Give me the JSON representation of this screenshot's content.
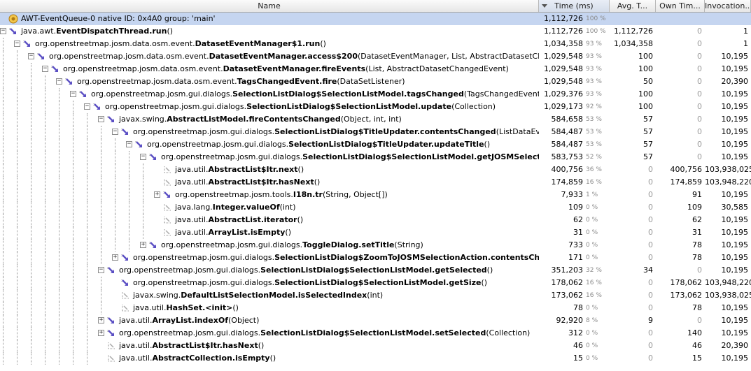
{
  "header": {
    "name": "Name",
    "time": "Time (ms)",
    "avg": "Avg. T...",
    "own": "Own Tim...",
    "inv": "Invocation..."
  },
  "rows": [
    {
      "depth": 0,
      "exp": "",
      "icon": "thread",
      "pre": "AWT-EventQueue-0 native ID: 0x4A0 group: 'main'",
      "bold": "",
      "post": "",
      "time": "1,112,726",
      "pct": "100 %",
      "avg": "",
      "own": "",
      "inv": "",
      "sel": true
    },
    {
      "depth": 0,
      "exp": "-",
      "icon": "method",
      "pre": "java.awt.",
      "bold": "EventDispatchThread.run",
      "post": "()",
      "time": "1,112,726",
      "pct": "100 %",
      "avg": "1,112,726",
      "own": "0",
      "inv": "1"
    },
    {
      "depth": 1,
      "exp": "-",
      "icon": "method",
      "pre": "org.openstreetmap.josm.data.osm.event.",
      "bold": "DatasetEventManager$1.run",
      "post": "()",
      "time": "1,034,358",
      "pct": "93 %",
      "avg": "1,034,358",
      "own": "0",
      "inv": "1"
    },
    {
      "depth": 2,
      "exp": "-",
      "icon": "method",
      "pre": "org.openstreetmap.josm.data.osm.event.",
      "bold": "DatasetEventManager.access$200",
      "post": "(DatasetEventManager, List, AbstractDatasetChangedEvent)",
      "time": "1,029,548",
      "pct": "93 %",
      "avg": "100",
      "own": "0",
      "inv": "10,195"
    },
    {
      "depth": 3,
      "exp": "-",
      "icon": "method",
      "pre": "org.openstreetmap.josm.data.osm.event.",
      "bold": "DatasetEventManager.fireEvents",
      "post": "(List, AbstractDatasetChangedEvent)",
      "time": "1,029,548",
      "pct": "93 %",
      "avg": "100",
      "own": "0",
      "inv": "10,195"
    },
    {
      "depth": 4,
      "exp": "-",
      "icon": "method",
      "pre": "org.openstreetmap.josm.data.osm.event.",
      "bold": "TagsChangedEvent.fire",
      "post": "(DataSetListener)",
      "time": "1,029,548",
      "pct": "93 %",
      "avg": "50",
      "own": "0",
      "inv": "20,390"
    },
    {
      "depth": 5,
      "exp": "-",
      "icon": "method",
      "pre": "org.openstreetmap.josm.gui.dialogs.",
      "bold": "SelectionListDialog$SelectionListModel.tagsChanged",
      "post": "(TagsChangedEvent)",
      "time": "1,029,376",
      "pct": "93 %",
      "avg": "100",
      "own": "0",
      "inv": "10,195"
    },
    {
      "depth": 6,
      "exp": "-",
      "icon": "method",
      "pre": "org.openstreetmap.josm.gui.dialogs.",
      "bold": "SelectionListDialog$SelectionListModel.update",
      "post": "(Collection)",
      "time": "1,029,173",
      "pct": "92 %",
      "avg": "100",
      "own": "0",
      "inv": "10,195"
    },
    {
      "depth": 7,
      "exp": "-",
      "icon": "method",
      "pre": "javax.swing.",
      "bold": "AbstractListModel.fireContentsChanged",
      "post": "(Object, int, int)",
      "time": "584,658",
      "pct": "53 %",
      "avg": "57",
      "own": "0",
      "inv": "10,195"
    },
    {
      "depth": 8,
      "exp": "-",
      "icon": "method",
      "pre": "org.openstreetmap.josm.gui.dialogs.",
      "bold": "SelectionListDialog$TitleUpdater.contentsChanged",
      "post": "(ListDataEvent)",
      "time": "584,487",
      "pct": "53 %",
      "avg": "57",
      "own": "0",
      "inv": "10,195"
    },
    {
      "depth": 9,
      "exp": "-",
      "icon": "method",
      "pre": "org.openstreetmap.josm.gui.dialogs.",
      "bold": "SelectionListDialog$TitleUpdater.updateTitle",
      "post": "()",
      "time": "584,487",
      "pct": "53 %",
      "avg": "57",
      "own": "0",
      "inv": "10,195"
    },
    {
      "depth": 10,
      "exp": "-",
      "icon": "method",
      "pre": "org.openstreetmap.josm.gui.dialogs.",
      "bold": "SelectionListDialog$SelectionListModel.getJOSMSelectionSum",
      "post": "",
      "time": "583,753",
      "pct": "52 %",
      "avg": "57",
      "own": "0",
      "inv": "10,195"
    },
    {
      "depth": 11,
      "exp": "",
      "icon": "leaf",
      "pre": "java.util.",
      "bold": "AbstractList$Itr.next",
      "post": "()",
      "time": "400,756",
      "pct": "36 %",
      "avg": "0",
      "own": "400,756",
      "inv": "103,938,025"
    },
    {
      "depth": 11,
      "exp": "",
      "icon": "leaf",
      "pre": "java.util.",
      "bold": "AbstractList$Itr.hasNext",
      "post": "()",
      "time": "174,859",
      "pct": "16 %",
      "avg": "0",
      "own": "174,859",
      "inv": "103,948,220"
    },
    {
      "depth": 11,
      "exp": "+",
      "icon": "method",
      "pre": "org.openstreetmap.josm.tools.",
      "bold": "I18n.tr",
      "post": "(String, Object[])",
      "time": "7,933",
      "pct": "1 %",
      "avg": "0",
      "own": "91",
      "inv": "10,195"
    },
    {
      "depth": 11,
      "exp": "",
      "icon": "leaf",
      "pre": "java.lang.",
      "bold": "Integer.valueOf",
      "post": "(int)",
      "time": "109",
      "pct": "0 %",
      "avg": "0",
      "own": "109",
      "inv": "30,585"
    },
    {
      "depth": 11,
      "exp": "",
      "icon": "leaf",
      "pre": "java.util.",
      "bold": "AbstractList.iterator",
      "post": "()",
      "time": "62",
      "pct": "0 %",
      "avg": "0",
      "own": "62",
      "inv": "10,195"
    },
    {
      "depth": 11,
      "exp": "",
      "icon": "leaf",
      "pre": "java.util.",
      "bold": "ArrayList.isEmpty",
      "post": "()",
      "time": "31",
      "pct": "0 %",
      "avg": "0",
      "own": "31",
      "inv": "10,195"
    },
    {
      "depth": 10,
      "exp": "+",
      "icon": "method",
      "pre": "org.openstreetmap.josm.gui.dialogs.",
      "bold": "ToggleDialog.setTitle",
      "post": "(String)",
      "time": "733",
      "pct": "0 %",
      "avg": "0",
      "own": "78",
      "inv": "10,195"
    },
    {
      "depth": 8,
      "exp": "+",
      "icon": "method",
      "pre": "org.openstreetmap.josm.gui.dialogs.",
      "bold": "SelectionListDialog$ZoomToJOSMSelectionAction.contentsChanged",
      "post": "(Li",
      "time": "171",
      "pct": "0 %",
      "avg": "0",
      "own": "78",
      "inv": "10,195"
    },
    {
      "depth": 7,
      "exp": "-",
      "icon": "method",
      "pre": "org.openstreetmap.josm.gui.dialogs.",
      "bold": "SelectionListDialog$SelectionListModel.getSelected",
      "post": "()",
      "time": "351,203",
      "pct": "32 %",
      "avg": "34",
      "own": "0",
      "inv": "10,195"
    },
    {
      "depth": 8,
      "exp": "",
      "icon": "method",
      "pre": "org.openstreetmap.josm.gui.dialogs.",
      "bold": "SelectionListDialog$SelectionListModel.getSize",
      "post": "()",
      "time": "178,062",
      "pct": "16 %",
      "avg": "0",
      "own": "178,062",
      "inv": "103,948,220"
    },
    {
      "depth": 8,
      "exp": "",
      "icon": "leaf",
      "pre": "javax.swing.",
      "bold": "DefaultListSelectionModel.isSelectedIndex",
      "post": "(int)",
      "time": "173,062",
      "pct": "16 %",
      "avg": "0",
      "own": "173,062",
      "inv": "103,938,025"
    },
    {
      "depth": 8,
      "exp": "",
      "icon": "leaf",
      "pre": "java.util.",
      "bold": "HashSet.<init>",
      "post": "()",
      "time": "78",
      "pct": "0 %",
      "avg": "0",
      "own": "78",
      "inv": "10,195"
    },
    {
      "depth": 7,
      "exp": "+",
      "icon": "method",
      "pre": "java.util.",
      "bold": "ArrayList.indexOf",
      "post": "(Object)",
      "time": "92,920",
      "pct": "8 %",
      "avg": "9",
      "own": "0",
      "inv": "10,195"
    },
    {
      "depth": 7,
      "exp": "+",
      "icon": "method",
      "pre": "org.openstreetmap.josm.gui.dialogs.",
      "bold": "SelectionListDialog$SelectionListModel.setSelected",
      "post": "(Collection)",
      "time": "312",
      "pct": "0 %",
      "avg": "0",
      "own": "140",
      "inv": "10,195"
    },
    {
      "depth": 7,
      "exp": "",
      "icon": "leaf",
      "pre": "java.util.",
      "bold": "AbstractList$Itr.hasNext",
      "post": "()",
      "time": "46",
      "pct": "0 %",
      "avg": "0",
      "own": "46",
      "inv": "20,390"
    },
    {
      "depth": 7,
      "exp": "",
      "icon": "leaf",
      "pre": "java.util.",
      "bold": "AbstractCollection.isEmpty",
      "post": "()",
      "time": "15",
      "pct": "0 %",
      "avg": "0",
      "own": "15",
      "inv": "10,195"
    }
  ],
  "colors": {
    "selection": "#c5d5f0",
    "arrow": "#5b4fc4",
    "header": "#e6e6e6"
  }
}
